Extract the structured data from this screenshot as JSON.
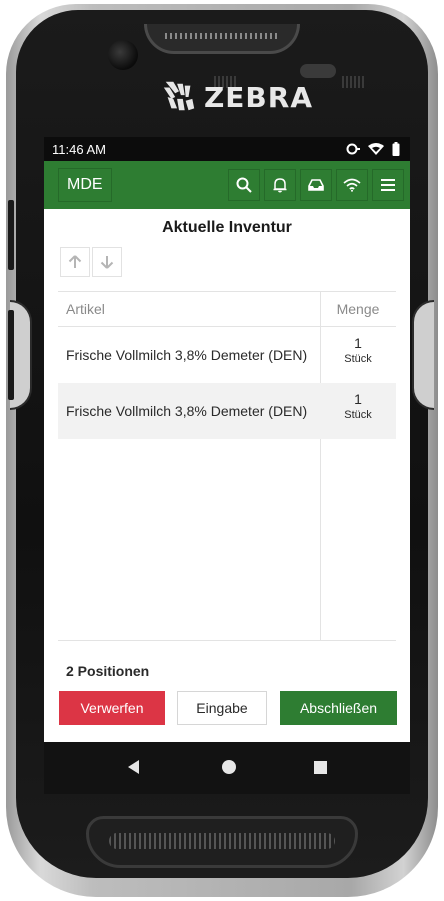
{
  "device": {
    "brand": "ZEBRA"
  },
  "status_bar": {
    "time": "11:46 AM",
    "icons": [
      "data-saver-icon",
      "wifi-icon",
      "battery-icon"
    ]
  },
  "app_bar": {
    "menu_label": "MDE",
    "actions": [
      "search-icon",
      "bell-icon",
      "inbox-icon",
      "wifi-icon",
      "hamburger-menu-icon"
    ],
    "color": "#2e7d32"
  },
  "page": {
    "title": "Aktuelle Inventur",
    "sort_buttons": [
      "arrow-up-icon",
      "arrow-down-icon"
    ]
  },
  "table": {
    "columns": [
      "Artikel",
      "Menge"
    ],
    "rows": [
      {
        "artikel": "Frische Vollmilch 3,8% Demeter (DEN)",
        "menge": "1",
        "einheit": "Stück"
      },
      {
        "artikel": "Frische Vollmilch 3,8% Demeter (DEN)",
        "menge": "1",
        "einheit": "Stück"
      }
    ]
  },
  "footer": {
    "positions": "2 Positionen",
    "buttons": {
      "discard": "Verwerfen",
      "input": "Eingabe",
      "finish": "Abschließen"
    }
  },
  "colors": {
    "primary_green": "#2e7d32",
    "danger_red": "#dc3545",
    "row_alt": "#f2f2f2"
  },
  "nav_bar": {
    "buttons": [
      "back-icon",
      "home-icon",
      "recents-icon"
    ]
  }
}
